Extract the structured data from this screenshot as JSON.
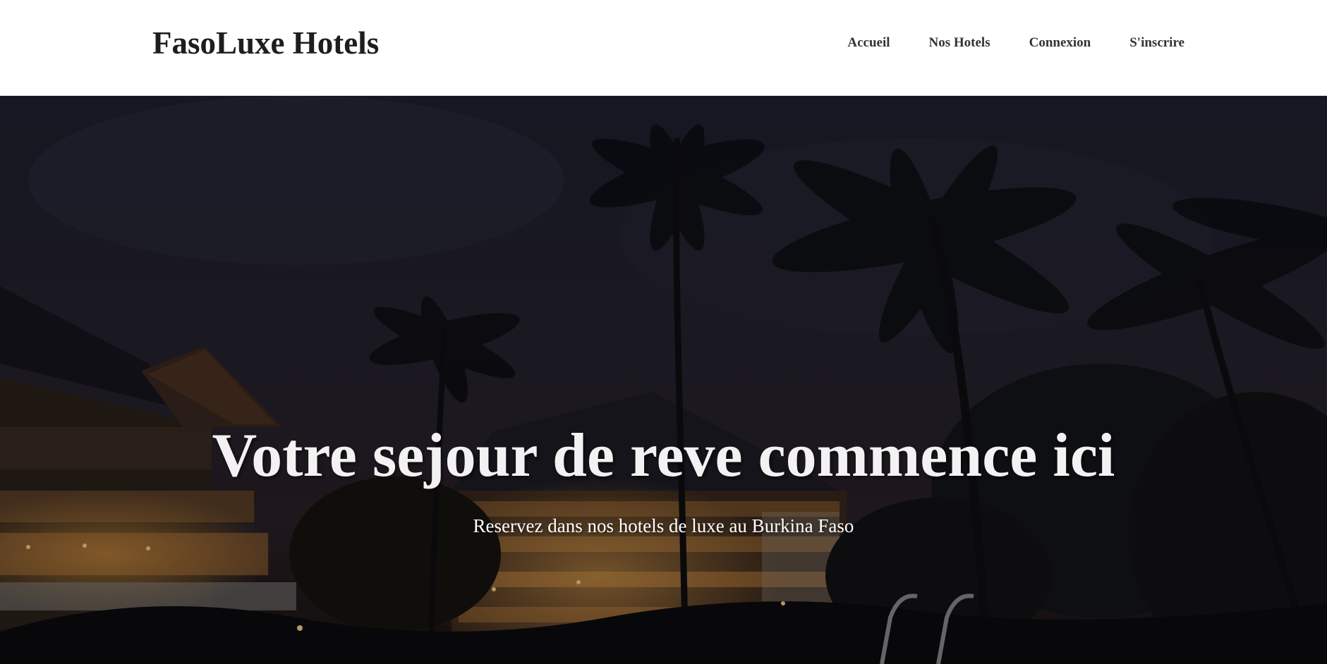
{
  "header": {
    "brand": "FasoLuxe Hotels",
    "nav": [
      {
        "label": "Accueil"
      },
      {
        "label": "Nos Hotels"
      },
      {
        "label": "Connexion"
      },
      {
        "label": "S'inscrire"
      }
    ]
  },
  "hero": {
    "title": "Votre sejour de reve commence ici",
    "subtitle": "Reservez dans nos hotels de luxe au Burkina Faso",
    "background_image": "night-tropical-resort-palm-trees",
    "overlay_color": "#000000"
  },
  "colors": {
    "header_bg": "#ffffff",
    "brand_text": "#1e1e1e",
    "nav_text": "#333333",
    "hero_text": "#f2f2f2",
    "sky": "#22222f"
  }
}
